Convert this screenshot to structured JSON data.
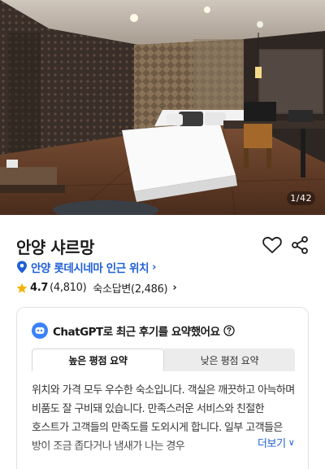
{
  "gallery": {
    "counter": "1/42"
  },
  "hotel": {
    "name": "안양 샤르망",
    "location": "안양 롯데시네마 인근 위치",
    "rating": "4.7",
    "review_count": "(4,810)",
    "host_answers": "숙소답변(2,486)"
  },
  "summary_card": {
    "title": "ChatGPT로 최근 후기를 요약했어요",
    "tabs": [
      {
        "label": "높은 평점 요약"
      },
      {
        "label": "낮은 평점 요약"
      }
    ],
    "text": "위치와 가격 모두 우수한 숙소입니다. 객실은 깨끗하고 아늑하며 비품도 잘 구비돼 있습니다. 만족스러운 서비스와 친절한 호스트가 고객들의 만족도를 도외시게 합니다. 일부 고객들은 방이 조금 좁다거나 냄새가 나는 경우",
    "more_label": "더보기"
  },
  "icons": {
    "heart": "heart-outline-icon",
    "share": "share-icon",
    "location": "location-pin-icon",
    "star": "star-icon",
    "chatbot": "chatbot-icon",
    "help": "help-circle-icon"
  },
  "colors": {
    "accent_blue": "#1f5fd6",
    "star_yellow": "#f5b400"
  }
}
